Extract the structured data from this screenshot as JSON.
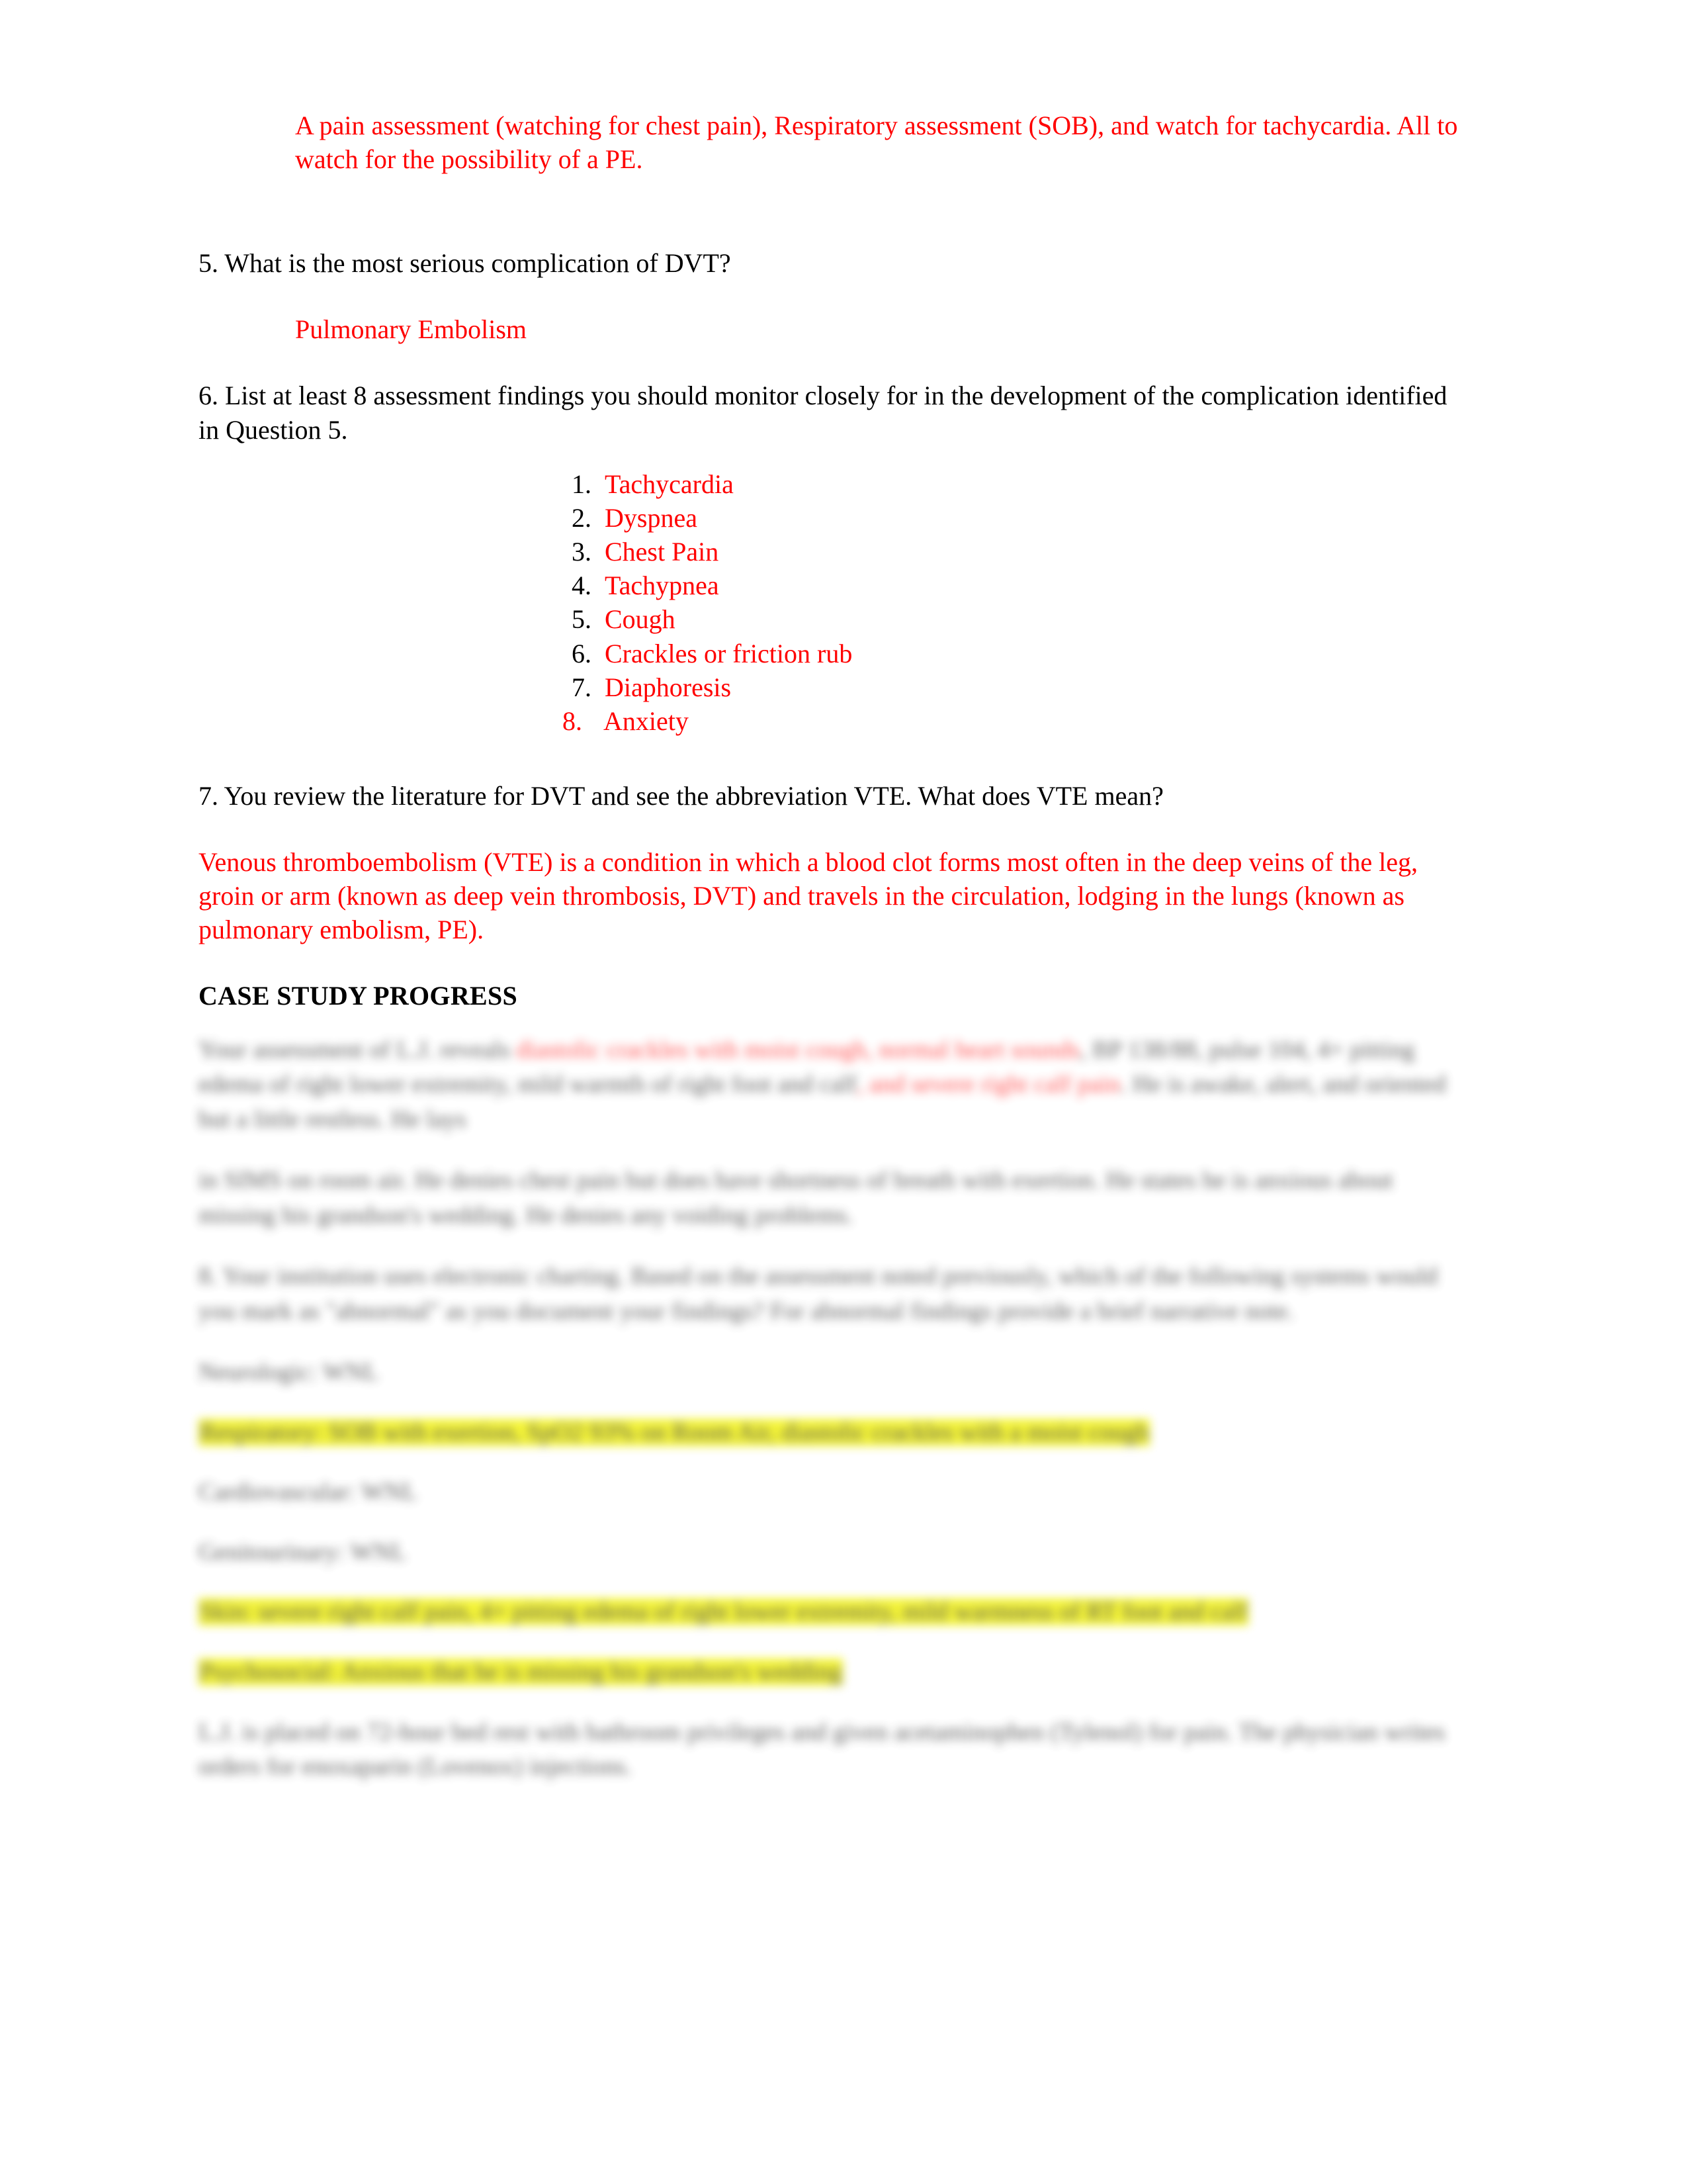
{
  "document": {
    "page_background": "#FFFFFF",
    "answer_color": "#FF0000",
    "question_color": "#000000",
    "highlight_color": "#F2F20C"
  },
  "answer_q4": {
    "text": "A pain assessment (watching for chest pain), Respiratory assessment (SOB), and watch for tachycardia. All to watch for the possibility of a PE."
  },
  "question_5": {
    "text": "5. What is the most serious complication of DVT?",
    "answer": "Pulmonary Embolism"
  },
  "question_6": {
    "text": "6. List at least 8 assessment findings you should monitor closely for in the development of the complication identified in Question 5.",
    "findings": [
      {
        "number": "1.",
        "label": "Tachycardia",
        "number_color": "#000000"
      },
      {
        "number": "2.",
        "label": "Dyspnea",
        "number_color": "#000000"
      },
      {
        "number": "3.",
        "label": "Chest Pain",
        "number_color": "#000000"
      },
      {
        "number": "4.",
        "label": "Tachypnea",
        "number_color": "#000000"
      },
      {
        "number": "5.",
        "label": "Cough",
        "number_color": "#000000"
      },
      {
        "number": "6.",
        "label": "Crackles or friction rub",
        "number_color": "#000000"
      },
      {
        "number": "7.",
        "label": "Diaphoresis",
        "number_color": "#000000"
      },
      {
        "number": "8.",
        "label": "Anxiety",
        "number_color": "#FF0000"
      }
    ]
  },
  "question_7": {
    "text": "7. You review the literature for DVT and see the abbreviation VTE. What does VTE mean?",
    "answer": "Venous thromboembolism (VTE) is a condition in which a blood clot forms most often in the deep veins of the leg, groin or arm (known as deep vein thrombosis, DVT) and travels in the circulation, lodging in the lungs (known as pulmonary embolism, PE)."
  },
  "case_study_progress": {
    "heading": "CASE STUDY PROGRESS",
    "note": "The paragraphs below this heading are visually blurred/redacted in the source screenshot and are not legible.",
    "blurred_blocks": [
      {
        "id": "progress-paragraph-1",
        "legible": false,
        "lines": 3,
        "has_red_text": true,
        "highlight": false
      },
      {
        "id": "progress-paragraph-2",
        "legible": false,
        "lines": 2,
        "has_red_text": false,
        "highlight": false
      },
      {
        "id": "progress-paragraph-3",
        "legible": false,
        "lines": 3,
        "has_red_text": false,
        "highlight": false
      },
      {
        "id": "progress-item-1",
        "legible": false,
        "lines": 1,
        "has_red_text": false,
        "highlight": false
      },
      {
        "id": "progress-item-2",
        "legible": false,
        "lines": 1,
        "has_red_text": false,
        "highlight": true
      },
      {
        "id": "progress-item-3",
        "legible": false,
        "lines": 1,
        "has_red_text": false,
        "highlight": false
      },
      {
        "id": "progress-item-4",
        "legible": false,
        "lines": 1,
        "has_red_text": false,
        "highlight": false
      },
      {
        "id": "progress-item-5",
        "legible": false,
        "lines": 2,
        "has_red_text": false,
        "highlight": true
      },
      {
        "id": "progress-item-6",
        "legible": false,
        "lines": 1,
        "has_red_text": false,
        "highlight": true
      },
      {
        "id": "progress-paragraph-4",
        "legible": false,
        "lines": 2,
        "has_red_text": false,
        "highlight": false
      }
    ],
    "obscured_text": {
      "p1_a": "Your assessment of L.J. reveals",
      "p1_red1": "diastolic crackles with moist cough, normal heart sounds",
      "p1_b": ", BP 138/88, pulse 104, 4+ pitting edema of right lower extremity, mild warmth of right foot and calf",
      "p1_red2": ", and severe right calf pain",
      "p1_c": ". He is awake, alert, and oriented but a little restless. He lays",
      "p2": "in SIMS on room air. He denies chest pain but does have shortness of breath with exertion. He states he is anxious about missing his grandson's wedding. He denies any voiding problems.",
      "p3": "8. Your institution uses electronic charting. Based on the assessment noted previously, which of the following systems would you mark as \"abnormal\" as you document your findings? For abnormal findings provide a brief narrative note.",
      "i1": "Neurologic: WNL",
      "i2": "Respiratory: SOB with exertion, SpO2 93% on Room Air, diastolic crackles with a moist cough",
      "i3": "Cardiovascular: WNL",
      "i4": "Genitourinary: WNL",
      "i5": "Skin: severe right calf pain, 4+ pitting edema of right lower extremity, mild warmness of RT foot and calf",
      "i6": "Psychosocial: Anxious that he is missing his grandson's wedding",
      "p4": "L.J. is placed on 72-hour bed rest with bathroom privileges and given acetaminophen (Tylenol) for pain. The physician writes orders for enoxaparin (Lovenox) injections."
    }
  }
}
